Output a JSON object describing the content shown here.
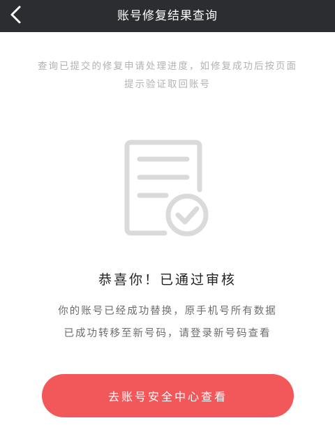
{
  "header": {
    "title": "账号修复结果查询",
    "back_icon": "chevron-left-icon"
  },
  "notice": {
    "line1": "查询已提交的修复申请处理进度，如修复成功后按页面",
    "line2": "提示验证取回账号"
  },
  "illustration": {
    "icon": "document-check-icon",
    "color": "#d9d9d9"
  },
  "result": {
    "headline": "恭喜你！已通过审核",
    "detail_line1": "你的账号已经成功替换，原手机号所有数据",
    "detail_line2": "已成功转移至新号码，请登录新号码查看"
  },
  "actions": {
    "primary_label": "去账号安全中心查看",
    "primary_color": "#f25759"
  },
  "colors": {
    "topbar": "#2b2d31",
    "muted_text": "#b2b2b2",
    "body_text": "#6d6d6d"
  }
}
